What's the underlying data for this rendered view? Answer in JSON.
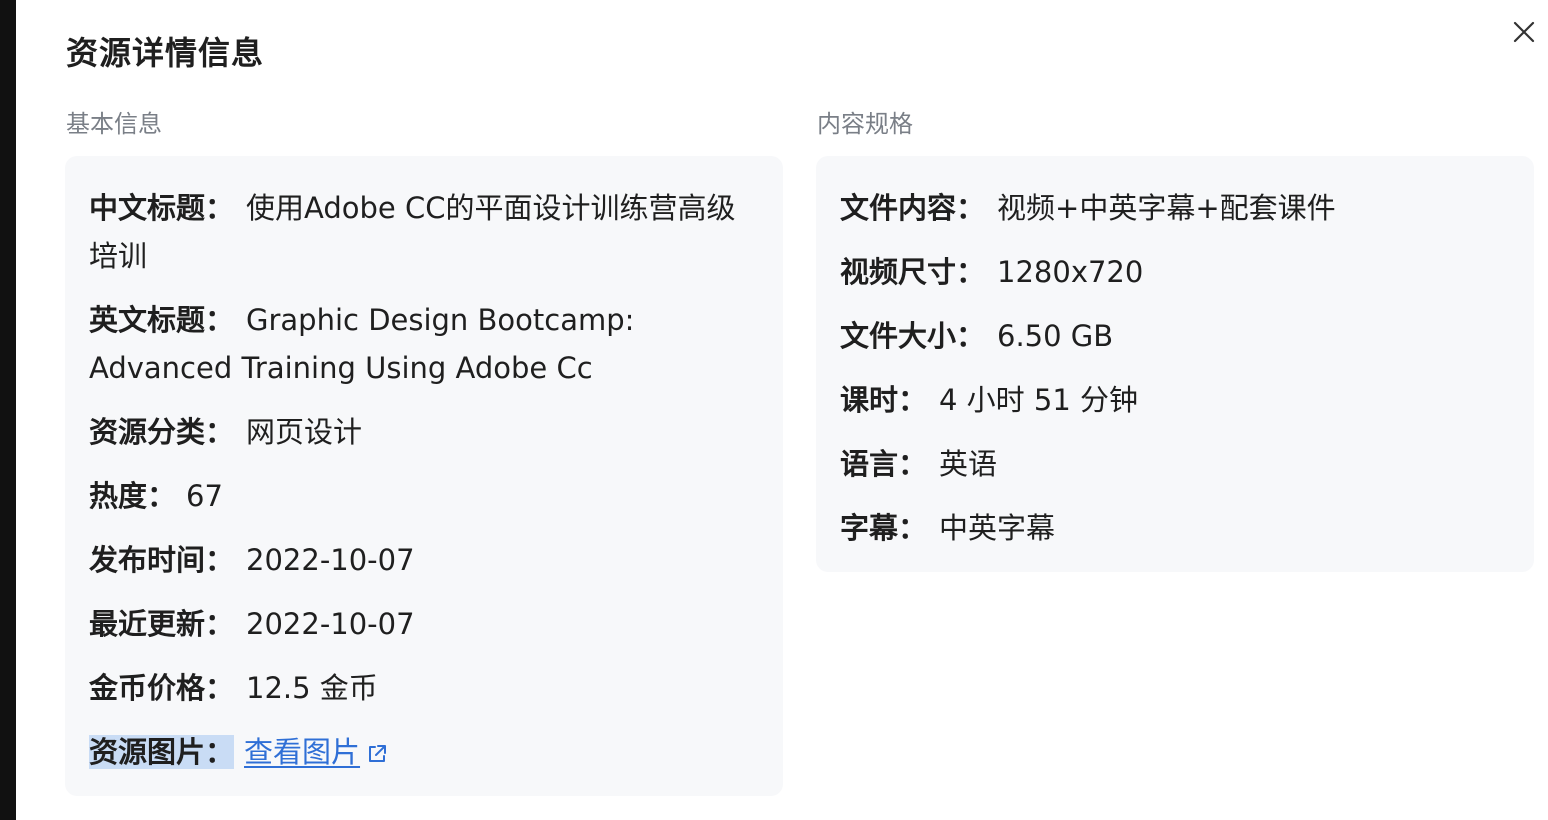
{
  "modal": {
    "title": "资源详情信息"
  },
  "basic": {
    "section_label": "基本信息",
    "rows": [
      {
        "key": "中文标题：",
        "value": "使用Adobe CC的平面设计训练营高级培训"
      },
      {
        "key": "英文标题：",
        "value": "Graphic Design Bootcamp: Advanced Training Using Adobe Cc"
      },
      {
        "key": "资源分类：",
        "value": "网页设计"
      },
      {
        "key": "热度：",
        "value": "67"
      },
      {
        "key": "发布时间：",
        "value": "2022-10-07"
      },
      {
        "key": "最近更新：",
        "value": "2022-10-07"
      },
      {
        "key": "金币价格：",
        "value": "12.5 金币"
      }
    ],
    "image_row": {
      "key": "资源图片：",
      "link_label": "查看图片"
    }
  },
  "spec": {
    "section_label": "内容规格",
    "rows": [
      {
        "key": "文件内容：",
        "value": "视频+中英字幕+配套课件"
      },
      {
        "key": "视频尺寸：",
        "value": "1280x720"
      },
      {
        "key": "文件大小：",
        "value": "6.50 GB"
      },
      {
        "key": "课时：",
        "value": "4 小时 51 分钟"
      },
      {
        "key": "语言：",
        "value": "英语"
      },
      {
        "key": "字幕：",
        "value": "中英字幕"
      }
    ]
  },
  "colors": {
    "link": "#2f6fd6",
    "card_bg": "#f7f8fa",
    "muted_label": "#7a7f87",
    "selection": "#c9dcf5"
  },
  "icons": {
    "close": "close-icon",
    "external_link": "external-link-icon"
  }
}
